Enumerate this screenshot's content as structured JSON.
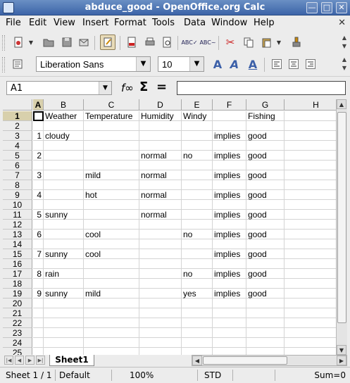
{
  "window": {
    "title": "abduce_good - OpenOffice.org Calc",
    "minimize": "—",
    "maximize": "□",
    "close": "✕"
  },
  "menu": [
    "File",
    "Edit",
    "View",
    "Insert",
    "Format",
    "Tools",
    "Data",
    "Window",
    "Help"
  ],
  "menu_close": "✕",
  "font": {
    "name": "Liberation Sans",
    "size": "10"
  },
  "namebox": {
    "value": "A1"
  },
  "formula": {
    "fx": "f∞",
    "sum": "Σ",
    "equals": "="
  },
  "columns": [
    "A",
    "B",
    "C",
    "D",
    "E",
    "F",
    "G",
    "H"
  ],
  "rows": [
    "1",
    "2",
    "3",
    "4",
    "5",
    "6",
    "7",
    "8",
    "9",
    "10",
    "11",
    "12",
    "13",
    "14",
    "15",
    "16",
    "17",
    "18",
    "19",
    "20",
    "21",
    "22",
    "23",
    "24",
    "25"
  ],
  "cells": {
    "1": [
      "",
      "Weather",
      "Temperature",
      "Humidity",
      "Windy",
      "",
      "Fishing",
      ""
    ],
    "3": [
      "1",
      "cloudy",
      "",
      "",
      "",
      "implies",
      "good",
      ""
    ],
    "5": [
      "2",
      "",
      "",
      "normal",
      "no",
      "implies",
      "good",
      ""
    ],
    "7": [
      "3",
      "",
      "mild",
      "normal",
      "",
      "implies",
      "good",
      ""
    ],
    "9": [
      "4",
      "",
      "hot",
      "normal",
      "",
      "implies",
      "good",
      ""
    ],
    "11": [
      "5",
      "sunny",
      "",
      "normal",
      "",
      "implies",
      "good",
      ""
    ],
    "13": [
      "6",
      "",
      "cool",
      "",
      "no",
      "implies",
      "good",
      ""
    ],
    "15": [
      "7",
      "sunny",
      "cool",
      "",
      "",
      "implies",
      "good",
      ""
    ],
    "17": [
      "8",
      "rain",
      "",
      "",
      "no",
      "implies",
      "good",
      ""
    ],
    "19": [
      "9",
      "sunny",
      "mild",
      "",
      "yes",
      "implies",
      "good",
      ""
    ]
  },
  "sheet_tab": "Sheet1",
  "status": {
    "sheet": "Sheet 1 / 1",
    "style": "Default",
    "zoom": "100%",
    "mode": "STD",
    "sum": "Sum=0"
  },
  "colors": {
    "title_bar": "#3c64a8",
    "header_selected": "#d8d0ac"
  }
}
